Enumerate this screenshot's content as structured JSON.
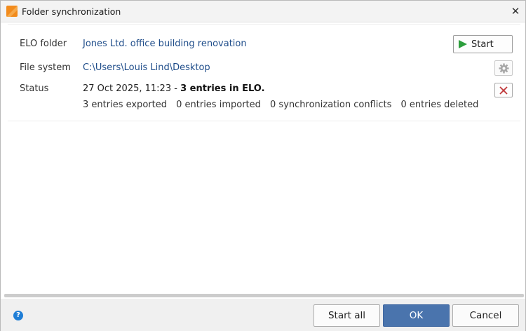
{
  "window": {
    "title": "Folder synchronization",
    "app_icon": "elo-orange-icon",
    "close_icon": "close-icon"
  },
  "fields": {
    "elo_folder_label": "ELO folder",
    "elo_folder_value": "Jones Ltd. office building renovation",
    "file_system_label": "File system",
    "file_system_value": "C:\\Users\\Louis Lind\\Desktop",
    "status_label": "Status",
    "status_date": "27 Oct 2025, 11:23 - ",
    "status_summary": "3 entries in ELO."
  },
  "stats": {
    "exported": "3 entries exported",
    "imported": "0 entries imported",
    "conflicts": "0 synchronization conflicts",
    "deleted": "0 entries deleted"
  },
  "actions": {
    "start_label": "Start",
    "start_icon": "play-icon",
    "settings_icon": "gear-icon",
    "delete_icon": "close-red-icon"
  },
  "footer": {
    "help_icon": "help-icon",
    "start_all_label": "Start all",
    "ok_label": "OK",
    "cancel_label": "Cancel"
  },
  "colors": {
    "link": "#1f4d8a",
    "ok_button": "#4a74ad",
    "play": "#2c9e3c",
    "delete": "#c0393b"
  }
}
